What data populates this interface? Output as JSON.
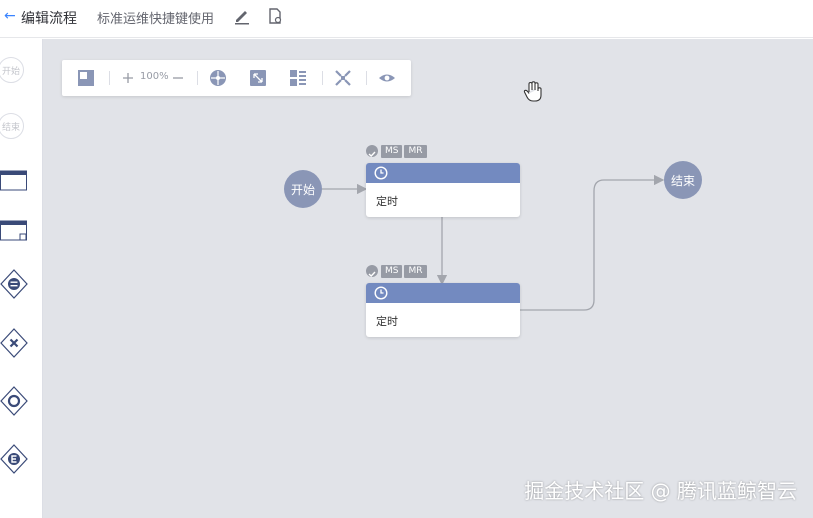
{
  "header": {
    "back_icon": "arrow-left-icon",
    "title": "编辑流程",
    "flow_name": "标准运维快捷键使用",
    "edit_icon": "pencil-icon",
    "doc_icon": "document-icon"
  },
  "palette": {
    "start_label": "开始",
    "end_label": "结束",
    "items": [
      "task-node-icon",
      "subprocess-node-icon",
      "parallel-gateway-icon",
      "branch-gateway-icon",
      "converge-gateway-icon",
      "conditional-parallel-gateway-icon"
    ]
  },
  "toolbar": {
    "zoom": "100%",
    "icons": [
      "layout-icon",
      "zoom-in-icon",
      "zoom-out-icon",
      "reset-position-icon",
      "fit-screen-icon",
      "format-layout-icon",
      "fullscreen-icon",
      "preview-icon"
    ]
  },
  "canvas": {
    "start_node": "开始",
    "end_node": "结束",
    "tasks": [
      {
        "label": "定时",
        "tags": [
          "MS",
          "MR"
        ]
      },
      {
        "label": "定时",
        "tags": [
          "MS",
          "MR"
        ]
      }
    ]
  },
  "watermark": "掘金技术社区 @ 腾讯蓝鲸智云",
  "colors": {
    "accent": "#3a84ff",
    "node": "#8a96b6",
    "task_header": "#738ac0",
    "canvas": "#e1e3e8"
  }
}
